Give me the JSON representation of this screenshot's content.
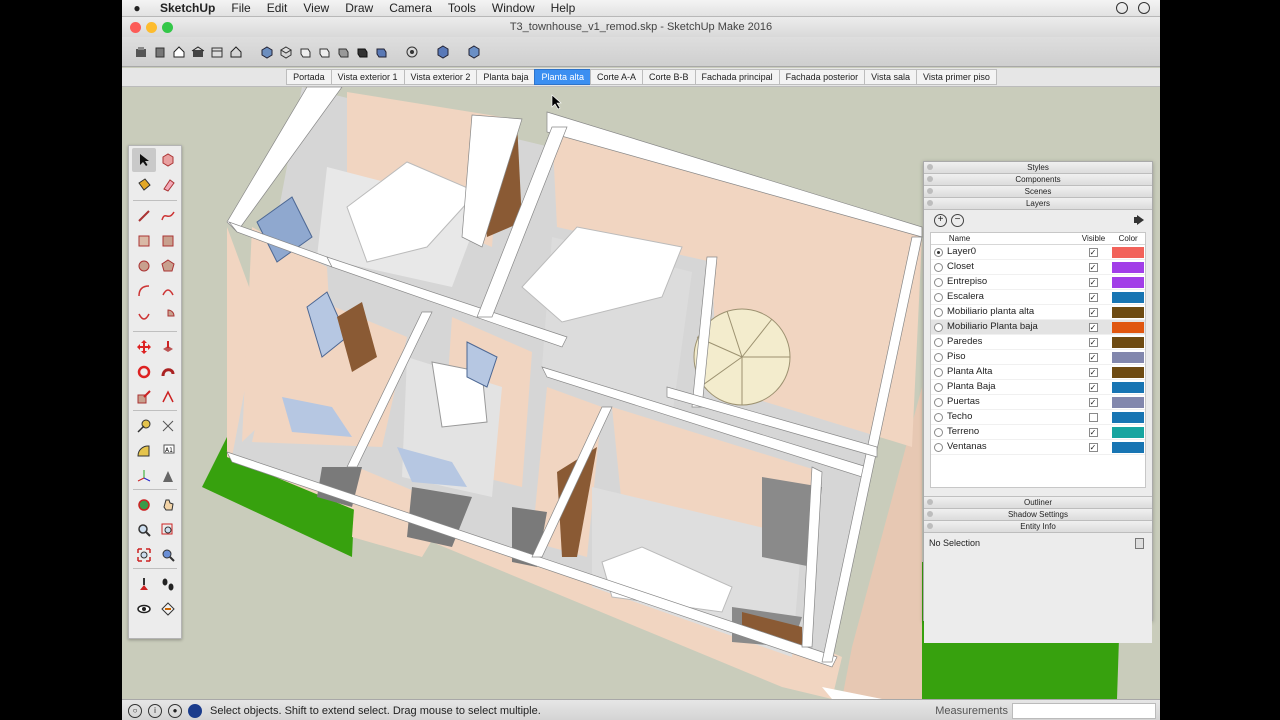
{
  "menubar": {
    "apple": "",
    "items": [
      "SketchUp",
      "File",
      "Edit",
      "View",
      "Draw",
      "Camera",
      "Tools",
      "Window",
      "Help"
    ]
  },
  "window": {
    "title": "T3_townhouse_v1_remod.skp - SketchUp Make 2016"
  },
  "toolbar": {
    "icons": [
      "get-models-icon",
      "share-model-icon",
      "house-icon",
      "warehouse-icon",
      "extension-icon",
      "house-outline-icon",
      "iso-view-icon",
      "top-view-icon",
      "front-view-icon",
      "right-view-icon",
      "back-view-icon",
      "left-view-icon",
      "xray-style-icon",
      "position-camera-icon",
      "walk-icon",
      "look-around-icon"
    ]
  },
  "scenes": {
    "tabs": [
      "Portada",
      "Vista exterior 1",
      "Vista exterior 2",
      "Planta baja",
      "Planta alta",
      "Corte A-A",
      "Corte B-B",
      "Fachada principal",
      "Fachada posterior",
      "Vista sala",
      "Vista primer piso"
    ],
    "active": "Planta alta"
  },
  "tray": {
    "sections_top": [
      "Styles",
      "Components",
      "Scenes",
      "Layers"
    ],
    "layers": {
      "col_name": "Name",
      "col_visible": "Visible",
      "col_color": "Color",
      "rows": [
        {
          "name": "Layer0",
          "active": true,
          "visible": true,
          "color": "#f2625a"
        },
        {
          "name": "Closet",
          "active": false,
          "visible": true,
          "color": "#a23ee8"
        },
        {
          "name": "Entrepiso",
          "active": false,
          "visible": true,
          "color": "#a23ee8"
        },
        {
          "name": "Escalera",
          "active": false,
          "visible": true,
          "color": "#1875b3"
        },
        {
          "name": "Mobiliario planta alta",
          "active": false,
          "visible": true,
          "color": "#6e4b12"
        },
        {
          "name": "Mobiliario Planta baja",
          "active": false,
          "visible": true,
          "color": "#e0560f"
        },
        {
          "name": "Paredes",
          "active": false,
          "visible": true,
          "color": "#6e4b12"
        },
        {
          "name": "Piso",
          "active": false,
          "visible": true,
          "color": "#8287ad"
        },
        {
          "name": "Planta Alta",
          "active": false,
          "visible": true,
          "color": "#6e4b12"
        },
        {
          "name": "Planta Baja",
          "active": false,
          "visible": true,
          "color": "#1875b3"
        },
        {
          "name": "Puertas",
          "active": false,
          "visible": true,
          "color": "#8287ad"
        },
        {
          "name": "Techo",
          "active": false,
          "visible": false,
          "color": "#1875b3"
        },
        {
          "name": "Terreno",
          "active": false,
          "visible": true,
          "color": "#17a5a0"
        },
        {
          "name": "Ventanas",
          "active": false,
          "visible": true,
          "color": "#1875b3"
        }
      ]
    },
    "sections_bottom": [
      "Outliner",
      "Shadow Settings",
      "Entity Info"
    ],
    "entity_info": "No Selection"
  },
  "status": {
    "message": "Select objects. Shift to extend select. Drag mouse to select multiple.",
    "measurements_label": "Measurements"
  },
  "colors": {
    "ground": "#c9ccbb",
    "grass": "#37a10e",
    "wall_interior": "#f1d5c1",
    "wall_top": "#ffffff",
    "floor": "#d6d6d6",
    "shadow": "#7a7a7a",
    "accent": "#3b8ff1"
  }
}
